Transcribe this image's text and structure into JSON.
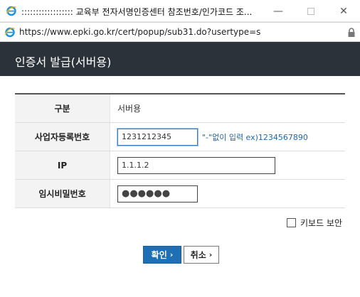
{
  "window": {
    "title": ":::::::::::::::::: 교육부 전자서명인증센터 참조번호/인가코드 조...",
    "url": "https://www.epki.go.kr/cert/popup/sub31.do?usertype=s",
    "minimize_glyph": "—",
    "close_glyph": "✕"
  },
  "page": {
    "title": "인증서 발급(서버용)"
  },
  "form": {
    "rows": [
      {
        "label": "구분",
        "value": "서버용"
      },
      {
        "label": "사업자등록번호",
        "value": "1231212345",
        "hint": "\"-\"없이 입력 ex)1234567890"
      },
      {
        "label": "IP",
        "value": "1.1.1.2"
      },
      {
        "label": "임시비밀번호",
        "value": "●●●●●●"
      }
    ]
  },
  "keyboard_security": {
    "label": "키보드 보안",
    "checked": false
  },
  "buttons": {
    "ok_label": "확인",
    "cancel_label": "취소",
    "chevron": "›"
  },
  "colors": {
    "header_bg": "#2b323a",
    "ok_button": "#1f6fb5",
    "hint_text": "#2266aa"
  }
}
